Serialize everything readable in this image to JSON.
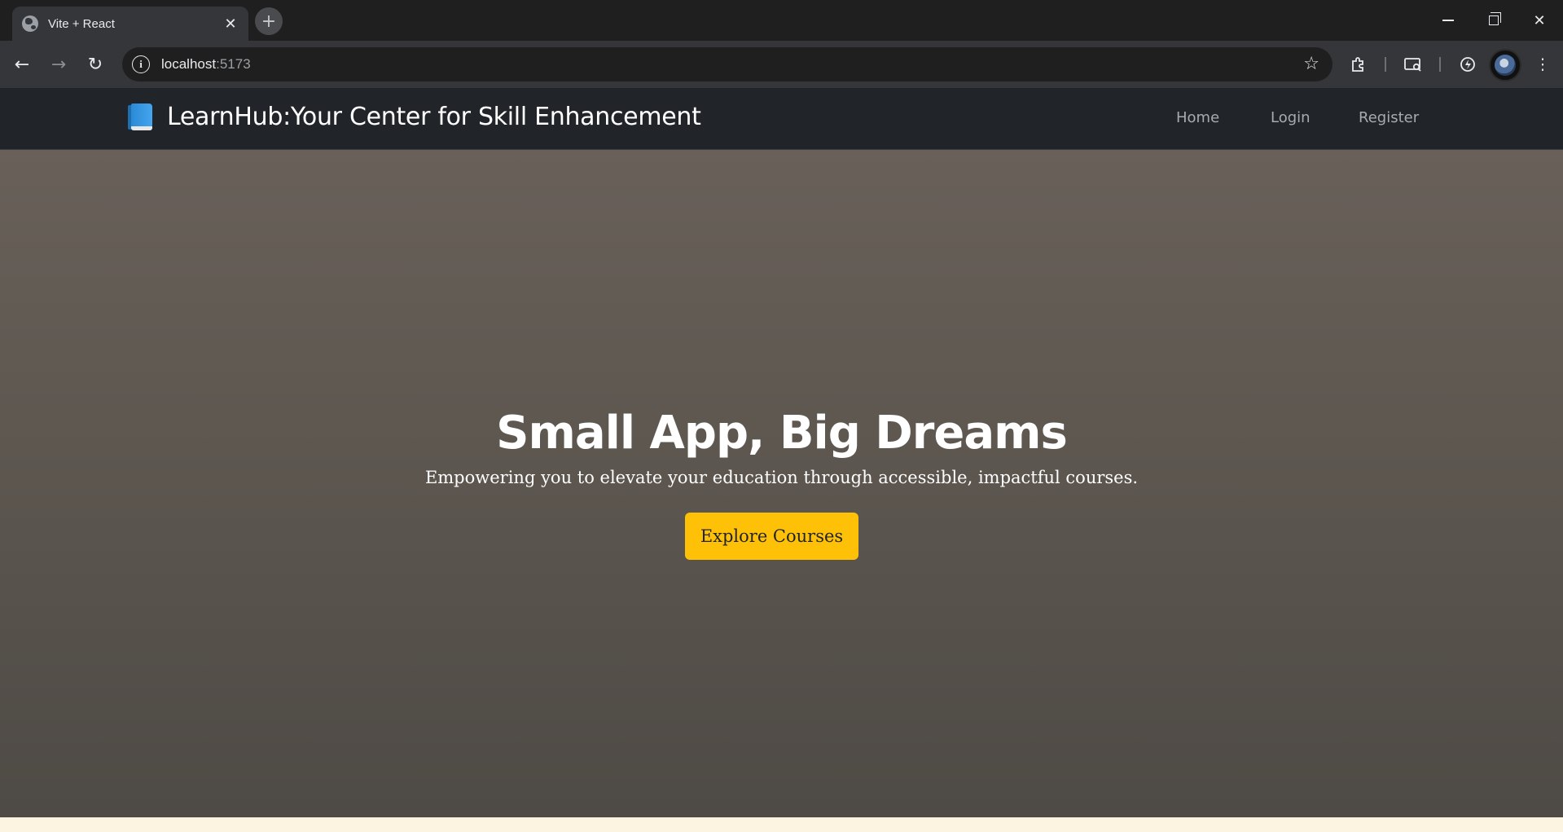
{
  "browser": {
    "tab_title": "Vite + React",
    "tab_close": "✕",
    "new_tab": "+",
    "url_host": "localhost",
    "url_port": ":5173",
    "back": "←",
    "forward": "→",
    "reload": "↻",
    "info": "i",
    "star": "☆",
    "minimize": "",
    "close": "✕",
    "menu": "⋮"
  },
  "navbar": {
    "brand": "LearnHub:Your Center for Skill Enhancement",
    "links": [
      {
        "label": "Home"
      },
      {
        "label": "Login"
      },
      {
        "label": "Register"
      }
    ]
  },
  "hero": {
    "title": "Small App, Big Dreams",
    "subtitle": "Empowering you to elevate your education through accessible, impactful courses.",
    "cta_label": "Explore Courses"
  },
  "colors": {
    "navbar_bg": "#212529",
    "cta_bg": "#ffc107",
    "hero_bg": "#5d5750"
  }
}
